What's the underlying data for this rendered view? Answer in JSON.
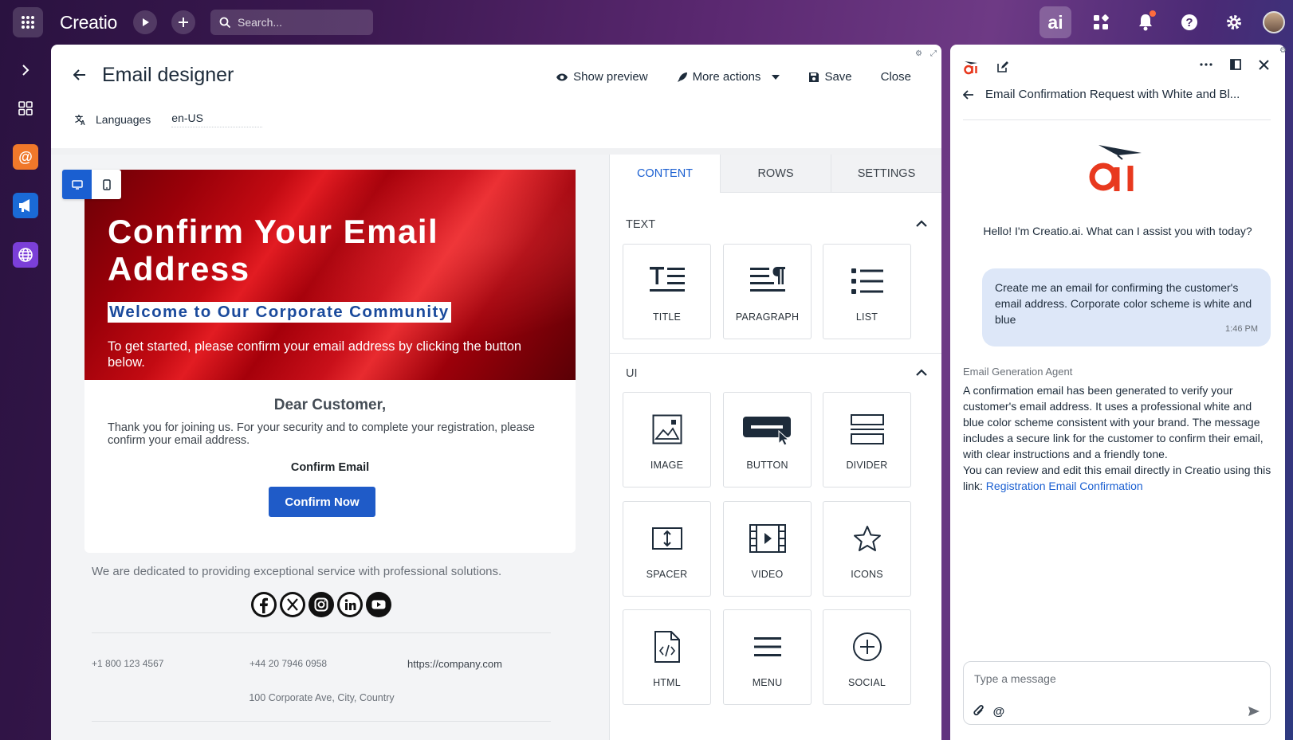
{
  "topbar": {
    "logo": "Creatio",
    "search_placeholder": "Search...",
    "ai_label": "ai"
  },
  "designer": {
    "title": "Email designer",
    "actions": {
      "show_preview": "Show preview",
      "more_actions": "More actions",
      "save": "Save",
      "close": "Close"
    },
    "languages_label": "Languages",
    "language_value": "en-US"
  },
  "email": {
    "hero_title": "Confirm Your Email Address",
    "hero_subtitle": "Welcome to Our Corporate Community",
    "hero_text": "To get started, please confirm your email address by clicking the button below.",
    "greeting": "Dear Customer,",
    "body": "Thank you for joining us. For your security and to complete your registration, please confirm your email address.",
    "confirm_label": "Confirm Email",
    "confirm_button": "Confirm Now",
    "footer_text": "We are dedicated to providing exceptional service with professional solutions.",
    "phone_1": "+1 800 123 4567",
    "phone_2": "+44 20 7946 0958",
    "website": "https://company.com",
    "address": "100 Corporate Ave, City, Country",
    "socials": [
      "facebook-icon",
      "x-icon",
      "instagram-icon",
      "linkedin-icon",
      "youtube-icon"
    ]
  },
  "panel": {
    "tabs": [
      "CONTENT",
      "ROWS",
      "SETTINGS"
    ],
    "text_section": "TEXT",
    "ui_section": "UI",
    "text_blocks": [
      "TITLE",
      "PARAGRAPH",
      "LIST"
    ],
    "ui_blocks": [
      "IMAGE",
      "BUTTON",
      "DIVIDER",
      "SPACER",
      "VIDEO",
      "ICONS",
      "HTML",
      "MENU",
      "SOCIAL"
    ]
  },
  "chat": {
    "title": "Email Confirmation Request with White and Bl...",
    "greeting": "Hello! I'm Creatio.ai. What can I assist you with today?",
    "user_message": "Create me an email for confirming the customer's email address. Corporate color scheme is white and blue",
    "user_time": "1:46 PM",
    "agent_name": "Email Generation Agent",
    "agent_message_1": "A confirmation email has been generated to verify your customer's email address. It uses a professional white and blue color scheme consistent with your brand. The message includes a secure link for the customer to confirm their email, with clear instructions and a friendly tone.",
    "agent_message_2": "You can review and edit this email directly in Creatio using this link: ",
    "agent_link": "Registration Email Confirmation",
    "input_placeholder": "Type a message"
  },
  "colors": {
    "accent": "#1a5fd1",
    "button_blue": "#1f5bc8",
    "ai_orange": "#e8391e",
    "hero_red": "#c20a12"
  }
}
